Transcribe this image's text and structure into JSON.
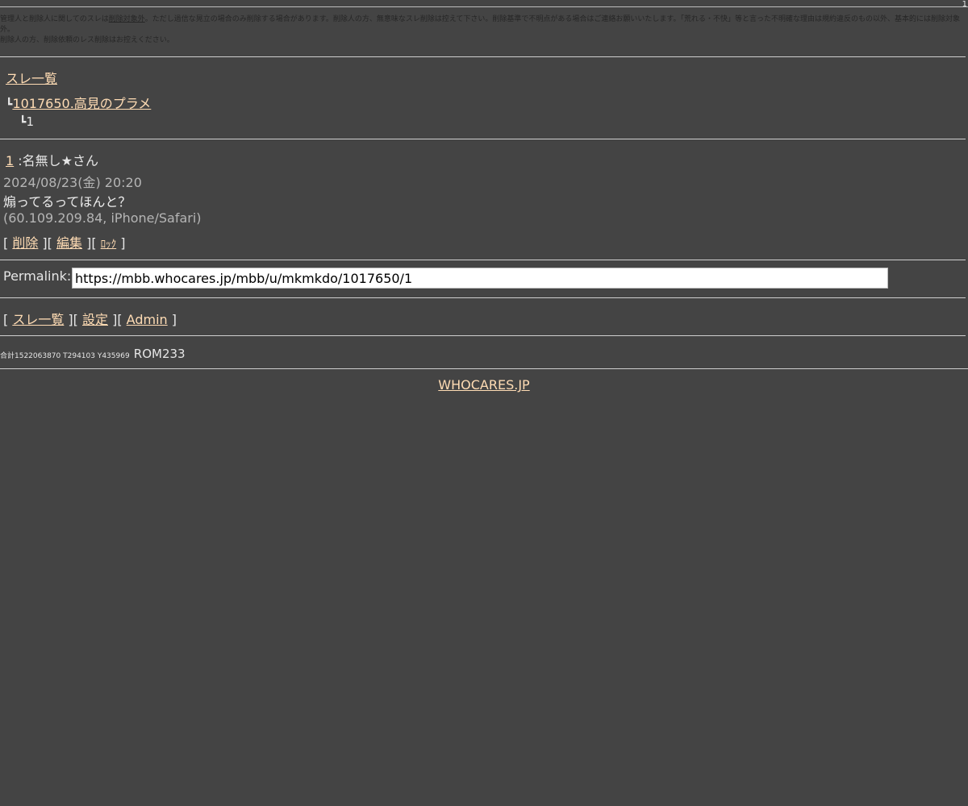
{
  "top_marker": "1",
  "notice": {
    "line1_a": "管理人と削除人に関してのスレは",
    "line1_link": "削除対象外",
    "line1_b": "。ただし過信な晃立の場合のみ削除する場合があります。削除人の方、無意味なスレ削除は控えて下さい。削除基準で不明点がある場合はご連絡お願いいたします。「荒れる・不快」等と言った不明確な理由は規約違反のもの以外、基本的には削除対象外。",
    "line2": "削除人の方、削除依頼のレス削除はお控えください。"
  },
  "breadcrumb": {
    "root": "スレ一覧",
    "corner": "┗",
    "thread": "1017650.高見のプラメ",
    "post": "1"
  },
  "post": {
    "number": "1",
    "name": " :名無し★さん",
    "date": "2024/08/23(金) 20:20",
    "body": "煽ってるってほんと？",
    "ip": "(60.109.209.84, iPhone/Safari)",
    "actions": {
      "delete": "削除",
      "edit": "編集",
      "lock": "ﾛｯｸ"
    }
  },
  "permalink": {
    "label": "Permalink:",
    "value": "https://mbb.whocares.jp/mbb/u/mkmkdo/1017650/1"
  },
  "bottom_nav": {
    "thread_list": "スレ一覧",
    "settings": "設定",
    "admin": "Admin"
  },
  "stats": {
    "counts": "合計1522063870 T294103 Y435969",
    "rom": "ROM233"
  },
  "footer": {
    "site": "WHOCARES.JP"
  }
}
